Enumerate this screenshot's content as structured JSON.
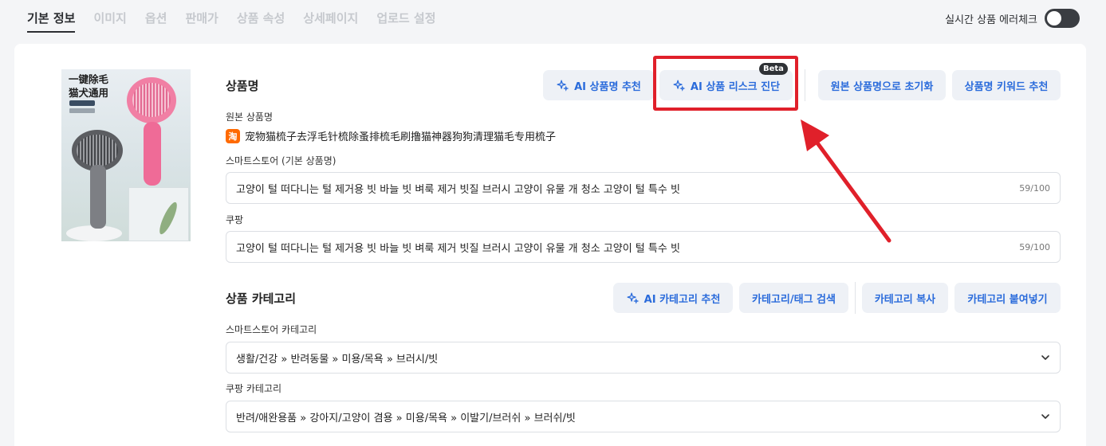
{
  "tabs": [
    {
      "label": "기본 정보",
      "active": true
    },
    {
      "label": "이미지"
    },
    {
      "label": "옵션"
    },
    {
      "label": "판매가"
    },
    {
      "label": "상품 속성"
    },
    {
      "label": "상세페이지"
    },
    {
      "label": "업로드 설정"
    }
  ],
  "realtime_check": {
    "label": "실시간 상품 에러체크",
    "enabled": false
  },
  "thumbnail": {
    "title_line1": "一键除毛",
    "title_line2": "猫犬通用"
  },
  "product_name": {
    "section_title": "상품명",
    "buttons": {
      "ai_name": "AI 상품명 추천",
      "ai_risk": "AI 상품 리스크 진단",
      "beta_badge": "Beta",
      "reset": "원본 상품명으로 초기화",
      "keyword": "상품명 키워드 추천"
    },
    "original_label": "원본 상품명",
    "original_icon": "淘",
    "original_value": "宠物猫梳子去浮毛针梳除蚤排梳毛刷撸猫神器狗狗清理猫毛专用梳子",
    "smartstore_label": "스마트스토어 (기본 상품명)",
    "smartstore_value": "고양이 털 떠다니는 털 제거용 빗 바늘 빗 벼룩 제거 빗질 브러시 고양이 유물 개 청소 고양이 털 특수 빗",
    "smartstore_count": "59/100",
    "coupang_label": "쿠팡",
    "coupang_value": "고양이 털 떠다니는 털 제거용 빗 바늘 빗 벼룩 제거 빗질 브러시 고양이 유물 개 청소 고양이 털 특수 빗",
    "coupang_count": "59/100"
  },
  "category": {
    "section_title": "상품 카테고리",
    "buttons": {
      "ai_category": "AI 카테고리 추천",
      "search": "카테고리/태그 검색",
      "copy": "카테고리 복사",
      "paste": "카테고리 붙여넣기"
    },
    "smartstore_label": "스마트스토어 카테고리",
    "smartstore_value": "생활/건강 » 반려동물 » 미용/목욕 » 브러시/빗",
    "coupang_label": "쿠팡 카테고리",
    "coupang_value": "반려/애완용품 » 강아지/고양이 겸용 » 미용/목욕 » 이발기/브러쉬 » 브러쉬/빗"
  },
  "colors": {
    "accent": "#2a6bdb",
    "highlight": "#e0202a",
    "button_bg": "#eef1f6"
  }
}
